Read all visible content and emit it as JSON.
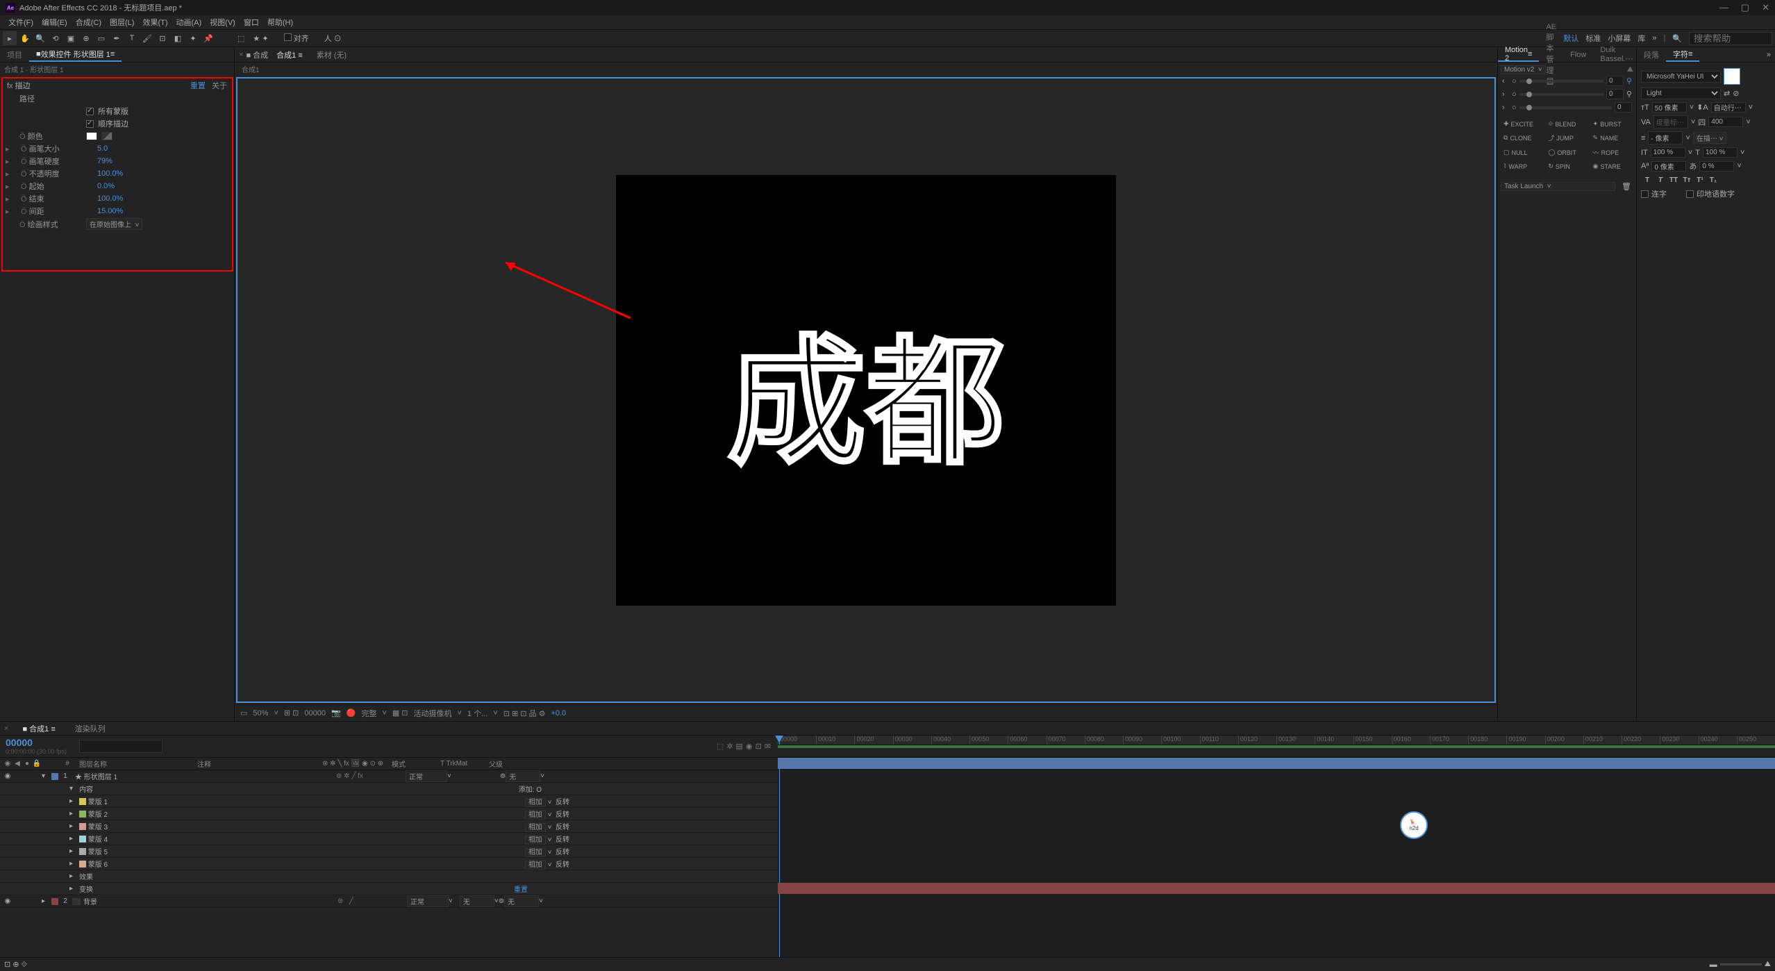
{
  "title": "Adobe After Effects CC 2018 - 无标题项目.aep *",
  "menu": [
    "文件(F)",
    "编辑(E)",
    "合成(C)",
    "图层(L)",
    "效果(T)",
    "动画(A)",
    "视图(V)",
    "窗口",
    "帮助(H)"
  ],
  "toolbar": {
    "snap": "对齐",
    "workspaces": [
      "默认",
      "标准",
      "小屏幕",
      "库"
    ],
    "search_placeholder": "搜索帮助"
  },
  "left_panel": {
    "tabs": [
      "项目",
      "效果控件 形状图层 1"
    ],
    "active_tab": 1,
    "breadcrumb": "合成 1 · 形状图层 1",
    "effect": {
      "name": "描边",
      "reset": "重置",
      "about": "关于",
      "path_label": "路径",
      "cb1": "所有蒙版",
      "cb2": "顺序描边",
      "color_label": "颜色",
      "props": [
        {
          "label": "画笔大小",
          "value": "5.0"
        },
        {
          "label": "画笔硬度",
          "value": "79%"
        },
        {
          "label": "不透明度",
          "value": "100.0%"
        },
        {
          "label": "起始",
          "value": "0.0%"
        },
        {
          "label": "结束",
          "value": "100.0%"
        },
        {
          "label": "间距",
          "value": "15.00%"
        }
      ],
      "paint_style_label": "绘画样式",
      "paint_style_value": "在原始图像上"
    }
  },
  "comp_panel": {
    "tabs_prefix": "合成",
    "tab1": "合成1",
    "tab2": "素材 (无)",
    "sub_tab": "合成1",
    "canvas_text": "成都",
    "controls": {
      "zoom": "50%",
      "time": "00000",
      "quality": "完整",
      "camera": "活动摄像机",
      "views": "1 个...",
      "exposure": "+0.0"
    }
  },
  "right_panel": {
    "tabs1": [
      "Motion 2",
      "AE脚本管理器",
      "Flow",
      "Duik Bassel.⋯"
    ],
    "motion_label": "Motion v2",
    "slider_vals": [
      "0",
      "0",
      "0"
    ],
    "buttons": [
      "EXCITE",
      "BLEND",
      "BURST",
      "CLONE",
      "JUMP",
      "NAME",
      "NULL",
      "ORBIT",
      "ROPE",
      "WARP",
      "SPIN",
      "STARE"
    ],
    "task_launch": "Task Launch",
    "tabs2": [
      "段落",
      "字符"
    ],
    "font": "Microsoft YaHei UI",
    "weight": "Light",
    "size": "50 像素",
    "leading": "自动行⋯",
    "tracking": "400",
    "vscale": "100 %",
    "hscale": "100 %",
    "baseline": "0 像素",
    "tsume": "0 %",
    "cb_ligature": "连字",
    "cb_hindi": "印地语数字"
  },
  "timeline": {
    "tabs": [
      "合成1",
      "渲染队列"
    ],
    "timecode": "00000",
    "timecode_sub": "0:00:00:00 (30.00 fps)",
    "search_placeholder": "",
    "columns": {
      "layer_name": "图层名称",
      "comment": "注释",
      "mode": "模式",
      "trkmat": "T TrkMat",
      "parent": "父级"
    },
    "ruler": [
      "00000",
      "00010",
      "00020",
      "00030",
      "00040",
      "00050",
      "00060",
      "00070",
      "00080",
      "00090",
      "00100",
      "00110",
      "00120",
      "00130",
      "00140",
      "00150",
      "00160",
      "00170",
      "00180",
      "00190",
      "00200",
      "00210",
      "00220",
      "00230",
      "00240",
      "00250"
    ],
    "layers": [
      {
        "num": "1",
        "name": "★ 形状图层 1",
        "color": "#5577aa",
        "mode": "正常",
        "parent": "无"
      },
      {
        "num": "2",
        "name": "背景",
        "color": "#884444",
        "mode": "正常",
        "parent": "无"
      }
    ],
    "sublayers": {
      "contents": "内容",
      "add": "添加:",
      "masks": [
        "蒙版 1",
        "蒙版 2",
        "蒙版 3",
        "蒙版 4",
        "蒙版 5",
        "蒙版 6"
      ],
      "mask_mode": "相加",
      "mask_invert": "反转",
      "effects": "效果",
      "transform": "变换",
      "reset": "重置"
    },
    "mask_colors": [
      "#d4c85a",
      "#8ab85a",
      "#d49a9a",
      "#9ad4d4",
      "#aaaaaa",
      "#d4aa8a"
    ]
  }
}
